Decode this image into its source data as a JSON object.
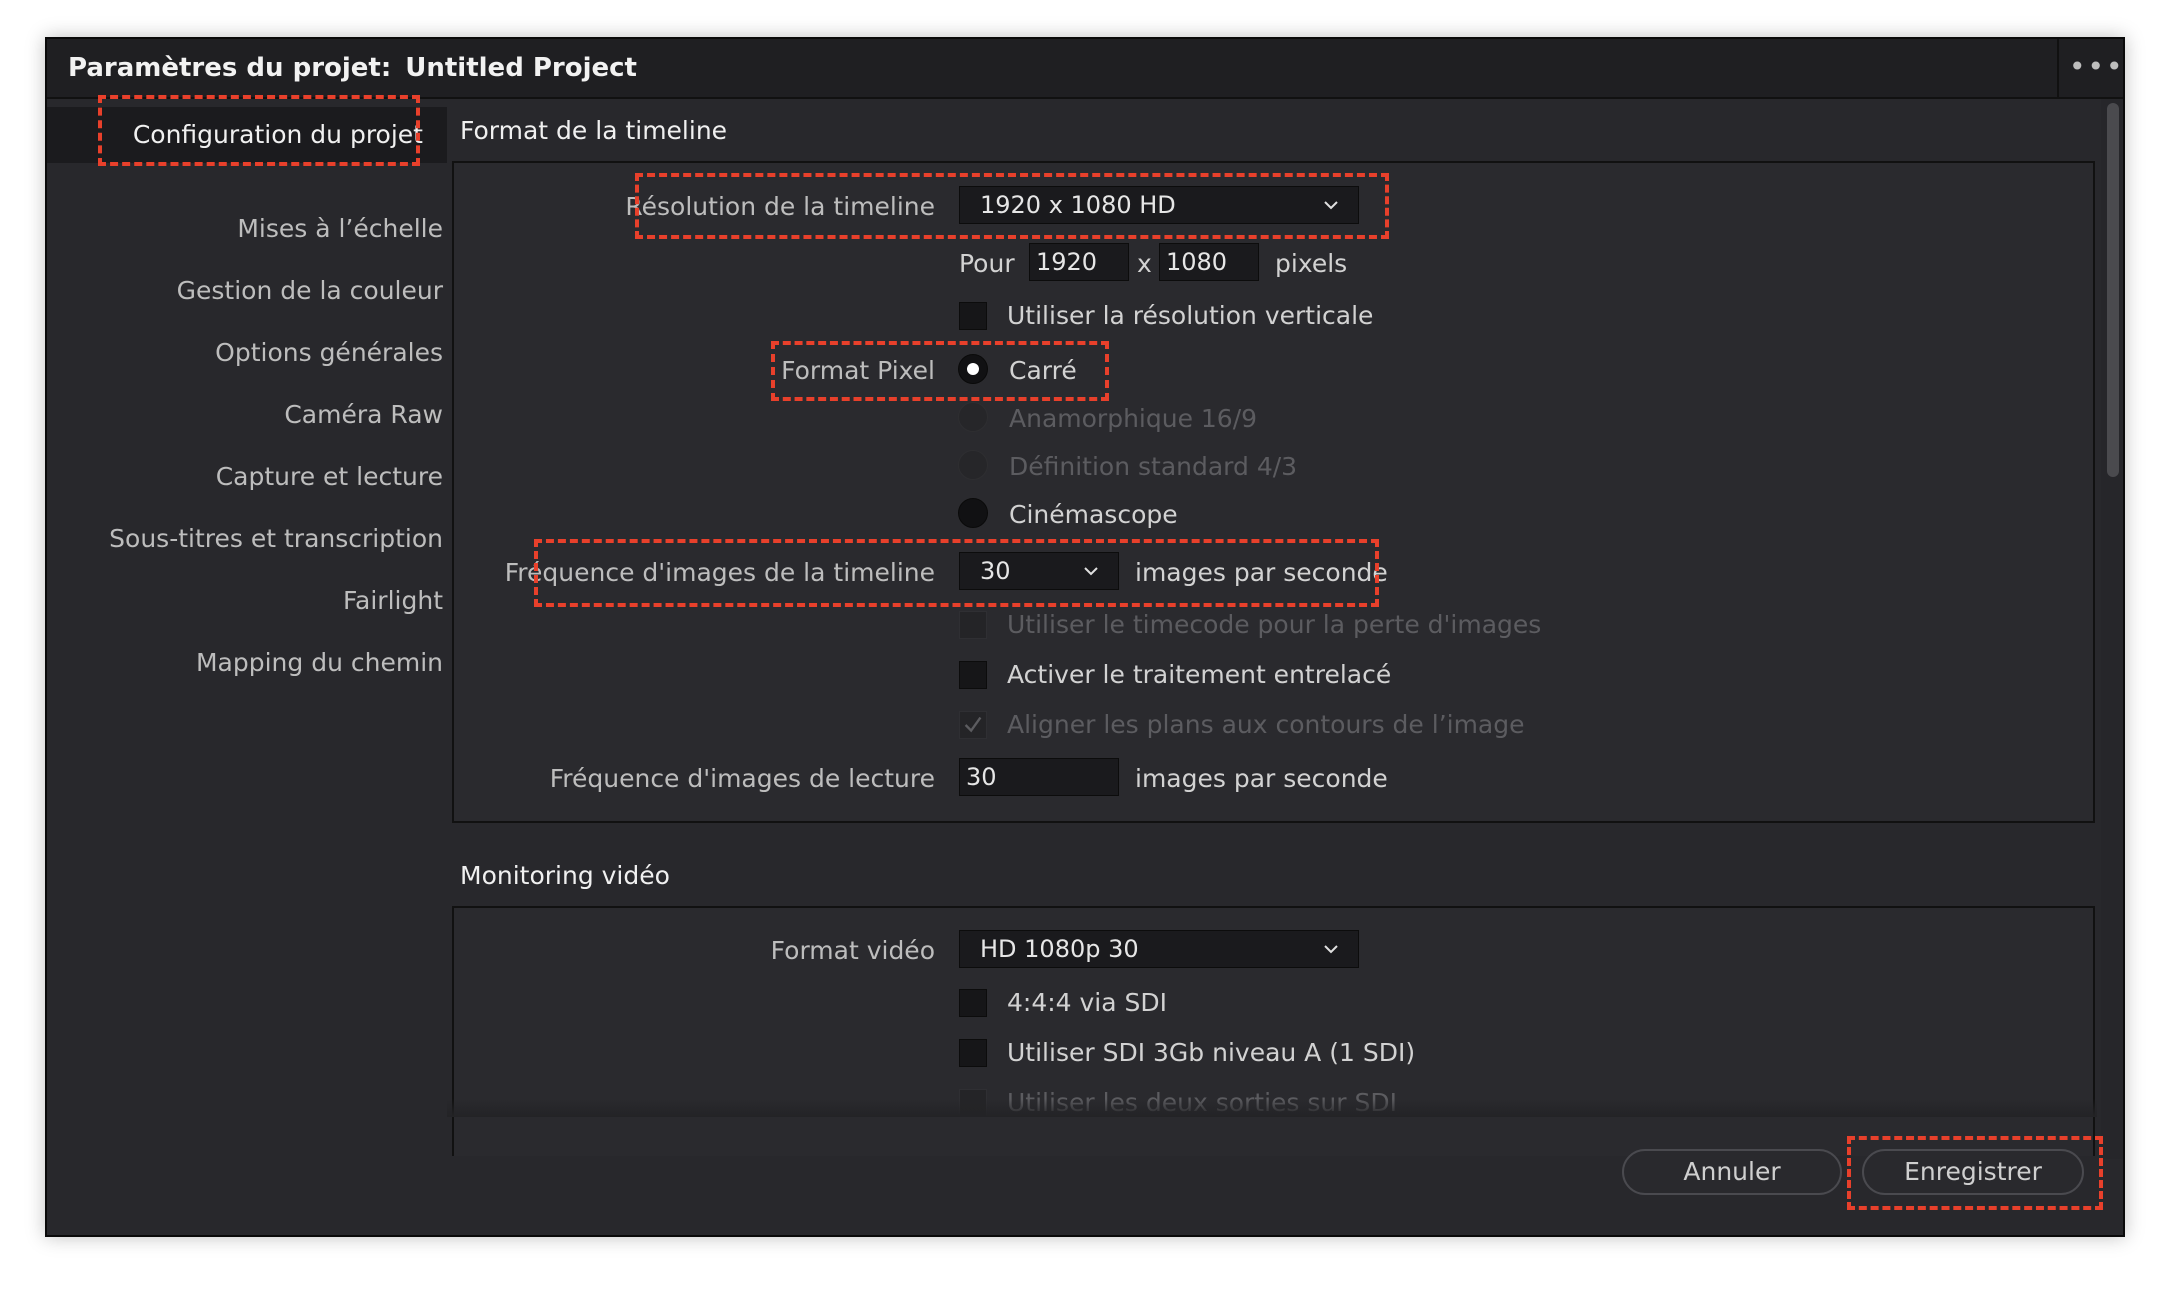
{
  "window": {
    "title_prefix": "Paramètres du projet:",
    "title_project": "Untitled Project",
    "menu_dots": "•••"
  },
  "sidebar": {
    "items": [
      {
        "label": "Configuration du projet",
        "active": true
      },
      {
        "label": "Mises à l’échelle"
      },
      {
        "label": "Gestion de la couleur"
      },
      {
        "label": "Options générales"
      },
      {
        "label": "Caméra Raw"
      },
      {
        "label": "Capture et lecture"
      },
      {
        "label": "Sous-titres et transcription"
      },
      {
        "label": "Fairlight"
      },
      {
        "label": "Mapping du chemin"
      }
    ]
  },
  "timeline_format": {
    "heading": "Format de la timeline",
    "resolution_label": "Résolution de la timeline",
    "resolution_value": "1920 x 1080 HD",
    "for_label": "Pour",
    "width": "1920",
    "x_label": "x",
    "height": "1080",
    "pixels_label": "pixels",
    "vertical_res_label": "Utiliser la résolution verticale",
    "pixel_format_label": "Format Pixel",
    "pixel_options": [
      {
        "label": "Carré",
        "selected": true,
        "enabled": true
      },
      {
        "label": "Anamorphique 16/9",
        "enabled": false
      },
      {
        "label": "Définition standard 4/3",
        "enabled": false
      },
      {
        "label": "Cinémascope",
        "enabled": true
      }
    ],
    "framerate_label": "Fréquence d'images de la timeline",
    "framerate_value": "30",
    "fps_label": "images par seconde",
    "drop_frame_label": "Utiliser le timecode pour la perte d'images",
    "interlace_label": "Activer le traitement entrelacé",
    "align_label": "Aligner les plans aux contours de l’image",
    "playback_rate_label": "Fréquence d'images de lecture",
    "playback_rate_value": "30",
    "playback_fps_label": "images par seconde"
  },
  "video_monitoring": {
    "heading": "Monitoring vidéo",
    "format_label": "Format vidéo",
    "format_value": "HD 1080p 30",
    "sdi444_label": "4:4:4 via SDI",
    "sdi3gb_label": "Utiliser SDI 3Gb niveau A (1 SDI)",
    "dual_sdi_label": "Utiliser les deux sorties sur SDI"
  },
  "footer": {
    "cancel_label": "Annuler",
    "save_label": "Enregistrer"
  },
  "colors": {
    "highlight": "#e8402b",
    "window_bg": "#28282c"
  }
}
